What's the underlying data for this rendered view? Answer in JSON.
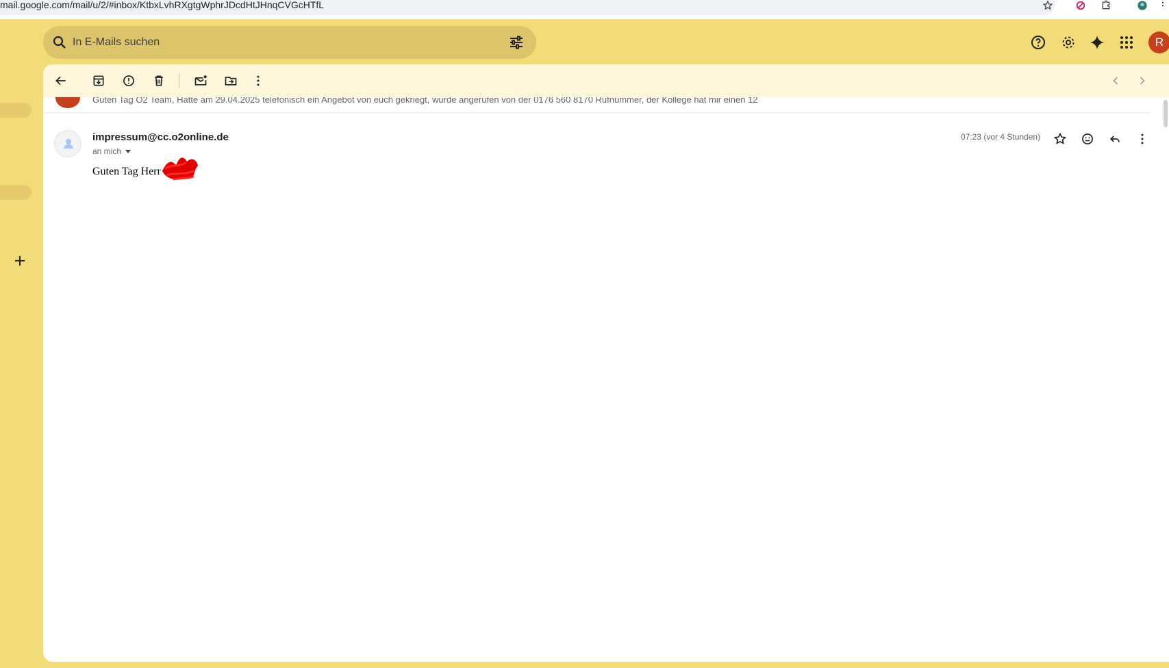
{
  "browser": {
    "url": "mail.google.com/mail/u/2/#inbox/KtbxLvhRXgtgWphrJDcdHtJHnqCVGcHTfL"
  },
  "header": {
    "search_placeholder": "In E-Mails suchen",
    "avatar_letter": "R",
    "avatar_color": "#c5401b"
  },
  "colors": {
    "theme_background": "#f3dc77",
    "toolbar_background": "#fdf6dc",
    "redaction": "#e00000"
  },
  "thread": {
    "previous_snippet": "Guten Tag O2 Team, Hatte am 29.04.2025 telefonisch ein Angebot von euch gekriegt, wurde angerufen von der 0176 560 8170 Rufnummer, der Kollege hat mir einen 12",
    "message": {
      "sender": "impressum@cc.o2online.de",
      "recipient": "an mich",
      "timestamp": "07:23 (vor 4 Stunden)",
      "body": "Guten Tag Herr"
    }
  }
}
